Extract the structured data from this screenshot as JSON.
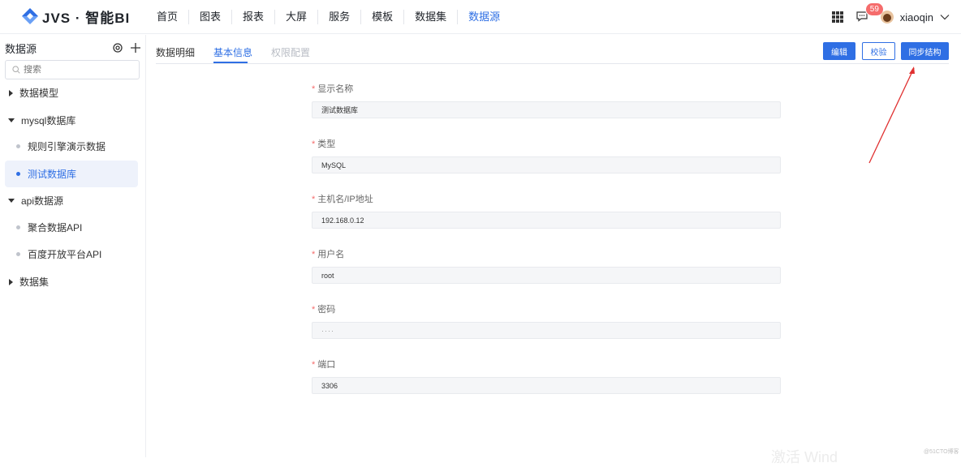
{
  "app": {
    "logo_text": "JVS · 智能BI"
  },
  "nav": [
    {
      "label": "首页",
      "active": false
    },
    {
      "label": "图表",
      "active": false
    },
    {
      "label": "报表",
      "active": false
    },
    {
      "label": "大屏",
      "active": false
    },
    {
      "label": "服务",
      "active": false
    },
    {
      "label": "模板",
      "active": false
    },
    {
      "label": "数据集",
      "active": false
    },
    {
      "label": "数据源",
      "active": true
    }
  ],
  "header": {
    "badge_count": "59",
    "username": "xiaoqin"
  },
  "sidebar": {
    "title": "数据源",
    "search_placeholder": "搜索",
    "items": [
      {
        "label": "数据模型",
        "type": "group",
        "expanded": false
      },
      {
        "label": "mysql数据库",
        "type": "group",
        "expanded": true
      },
      {
        "label": "规则引擎演示数据",
        "type": "leaf"
      },
      {
        "label": "测试数据库",
        "type": "leaf",
        "selected": true
      },
      {
        "label": "api数据源",
        "type": "group",
        "expanded": true
      },
      {
        "label": "聚合数据API",
        "type": "leaf"
      },
      {
        "label": "百度开放平台API",
        "type": "leaf"
      },
      {
        "label": "数据集",
        "type": "group",
        "expanded": false
      }
    ]
  },
  "tabs": [
    {
      "label": "数据明细",
      "state": "normal"
    },
    {
      "label": "基本信息",
      "state": "active"
    },
    {
      "label": "权限配置",
      "state": "disabled"
    }
  ],
  "actions": {
    "edit": "编辑",
    "verify": "校验",
    "sync": "同步结构"
  },
  "form": [
    {
      "label": "显示名称",
      "value": "测试数据库"
    },
    {
      "label": "类型",
      "value": "MySQL"
    },
    {
      "label": "主机名/IP地址",
      "value": "192.168.0.12"
    },
    {
      "label": "用户名",
      "value": "root"
    },
    {
      "label": "密码",
      "value": "····"
    },
    {
      "label": "端口",
      "value": "3306"
    }
  ],
  "overlay": {
    "watermark": "激活 Wind",
    "credit": "@51CTO博客"
  },
  "colors": {
    "accent": "#2f6fe4",
    "required": "#f56c6c",
    "badge": "#f56c6c",
    "annotation_arrow": "#e03030"
  }
}
